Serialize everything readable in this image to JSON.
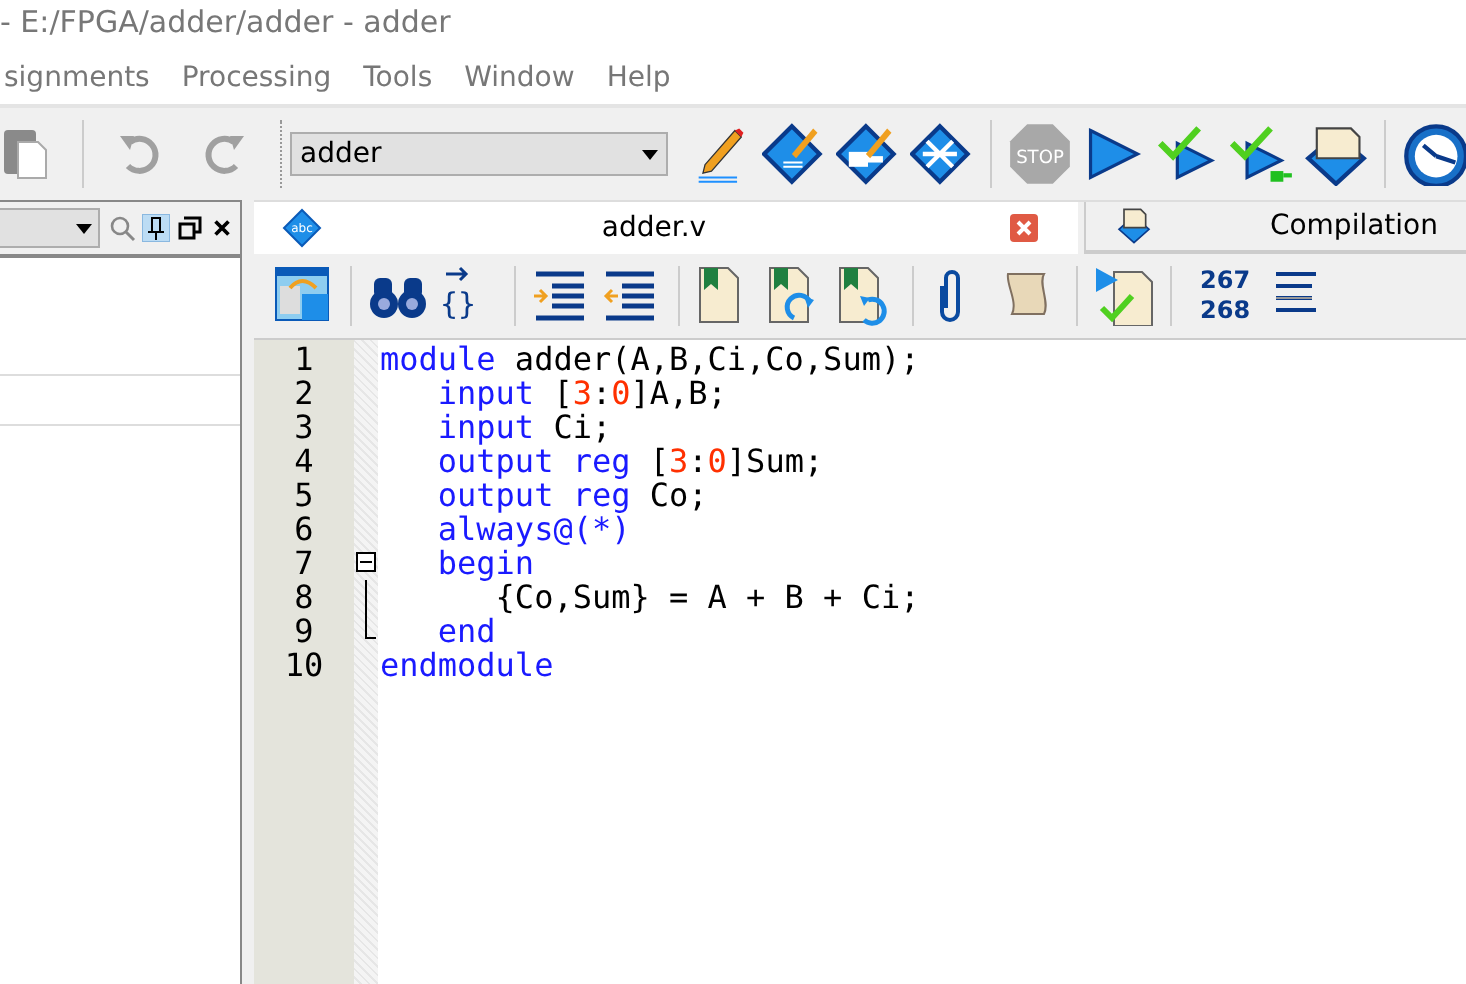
{
  "window": {
    "title": "- E:/FPGA/adder/adder - adder"
  },
  "menu": [
    "signments",
    "Processing",
    "Tools",
    "Window",
    "Help"
  ],
  "toolbar": {
    "entity": "adder",
    "stop_label": "STOP"
  },
  "tabs": [
    {
      "label": "adder.v",
      "icon_label": "abc",
      "selected": true,
      "closable": true
    },
    {
      "label": "Compilation",
      "selected": false,
      "closable": false
    }
  ],
  "editor_toolbar": {
    "braces_label": "{}",
    "line_counter": [
      "267",
      "268"
    ]
  },
  "code": [
    {
      "number": "1",
      "kind": "plain",
      "tokens": [
        {
          "kind": "keyword",
          "text": "module"
        },
        {
          "kind": "plain",
          "text": " adder(A,B,Ci,Co,Sum);"
        }
      ]
    },
    {
      "number": "2",
      "kind": "plain",
      "tokens": [
        {
          "kind": "keyword",
          "text": "   input"
        },
        {
          "kind": "plain",
          "text": " ["
        },
        {
          "kind": "number",
          "text": "3"
        },
        {
          "kind": "plain",
          "text": ":"
        },
        {
          "kind": "number",
          "text": "0"
        },
        {
          "kind": "plain",
          "text": "]A,B;"
        }
      ]
    },
    {
      "number": "3",
      "kind": "plain",
      "tokens": [
        {
          "kind": "keyword",
          "text": "   input"
        },
        {
          "kind": "plain",
          "text": " Ci;"
        }
      ]
    },
    {
      "number": "4",
      "kind": "plain",
      "tokens": [
        {
          "kind": "keyword",
          "text": "   output reg"
        },
        {
          "kind": "plain",
          "text": " ["
        },
        {
          "kind": "number",
          "text": "3"
        },
        {
          "kind": "plain",
          "text": ":"
        },
        {
          "kind": "number",
          "text": "0"
        },
        {
          "kind": "plain",
          "text": "]Sum;"
        }
      ]
    },
    {
      "number": "5",
      "kind": "plain",
      "tokens": [
        {
          "kind": "keyword",
          "text": "   output reg"
        },
        {
          "kind": "plain",
          "text": " Co;"
        }
      ]
    },
    {
      "number": "6",
      "kind": "plain",
      "tokens": [
        {
          "kind": "keyword",
          "text": "   always@(*)"
        }
      ]
    },
    {
      "number": "7",
      "kind": "foldstart",
      "tokens": [
        {
          "kind": "keyword",
          "text": "   begin"
        }
      ]
    },
    {
      "number": "8",
      "kind": "foldbody",
      "tokens": [
        {
          "kind": "plain",
          "text": "      {Co,Sum} = A + B + Ci;"
        }
      ]
    },
    {
      "number": "9",
      "kind": "foldend",
      "tokens": [
        {
          "kind": "keyword",
          "text": "   end"
        }
      ]
    },
    {
      "number": "10",
      "kind": "plain",
      "tokens": [
        {
          "kind": "keyword",
          "text": "endmodule"
        }
      ]
    }
  ]
}
